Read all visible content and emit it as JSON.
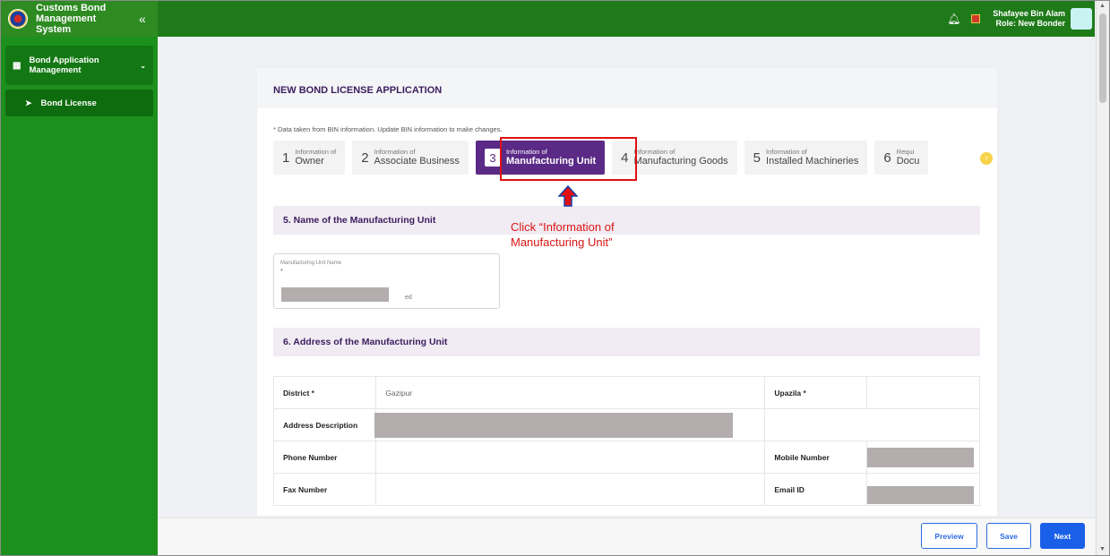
{
  "app": {
    "title": "Customs Bond Management System",
    "collapse_icon": "«"
  },
  "header": {
    "user_name": "Shafayee Bin Alam",
    "user_role": "Role: New Bonder"
  },
  "sidebar": {
    "group_label": "Bond Application Management",
    "items": [
      {
        "label": "Bond License"
      }
    ]
  },
  "card": {
    "title": "NEW BOND LICENSE APPLICATION",
    "note": "* Data taken from BIN information. Update BIN information to make changes."
  },
  "steps": [
    {
      "num": "1",
      "small": "Information of",
      "big": "Owner"
    },
    {
      "num": "2",
      "small": "Information of",
      "big": "Associate Business"
    },
    {
      "num": "3",
      "small": "Information of",
      "big": "Manufacturing Unit",
      "active": true
    },
    {
      "num": "4",
      "small": "Information of",
      "big": "Manufacturing Goods"
    },
    {
      "num": "5",
      "small": "Information of",
      "big": "Installed Machineries"
    },
    {
      "num": "6",
      "small": "Requi",
      "big": "Docu"
    }
  ],
  "annotation": {
    "line1": "Click “Information of",
    "line2": "Manufacturing Unit”"
  },
  "section5": {
    "title": "5. Name of the Manufacturing Unit",
    "field_label": "Manufacturing Unit Name",
    "required_mark": "*",
    "value_tail": "ed"
  },
  "section6": {
    "title": "6. Address of the Manufacturing Unit",
    "district_label": "District",
    "district_value": "Gazipur",
    "upazila_label": "Upazila",
    "address_label": "Address Description",
    "phone_label": "Phone Number",
    "mobile_label": "Mobile Number",
    "fax_label": "Fax Number",
    "email_label": "Email ID"
  },
  "actions": {
    "preview": "Preview",
    "save": "Save",
    "next": "Next"
  },
  "colors": {
    "topbar": "#1f7a1a",
    "sidebar": "#1c8f1c",
    "active_step": "#5a2a86",
    "primary_button": "#1a5fe8",
    "annotation": "#d91414"
  }
}
